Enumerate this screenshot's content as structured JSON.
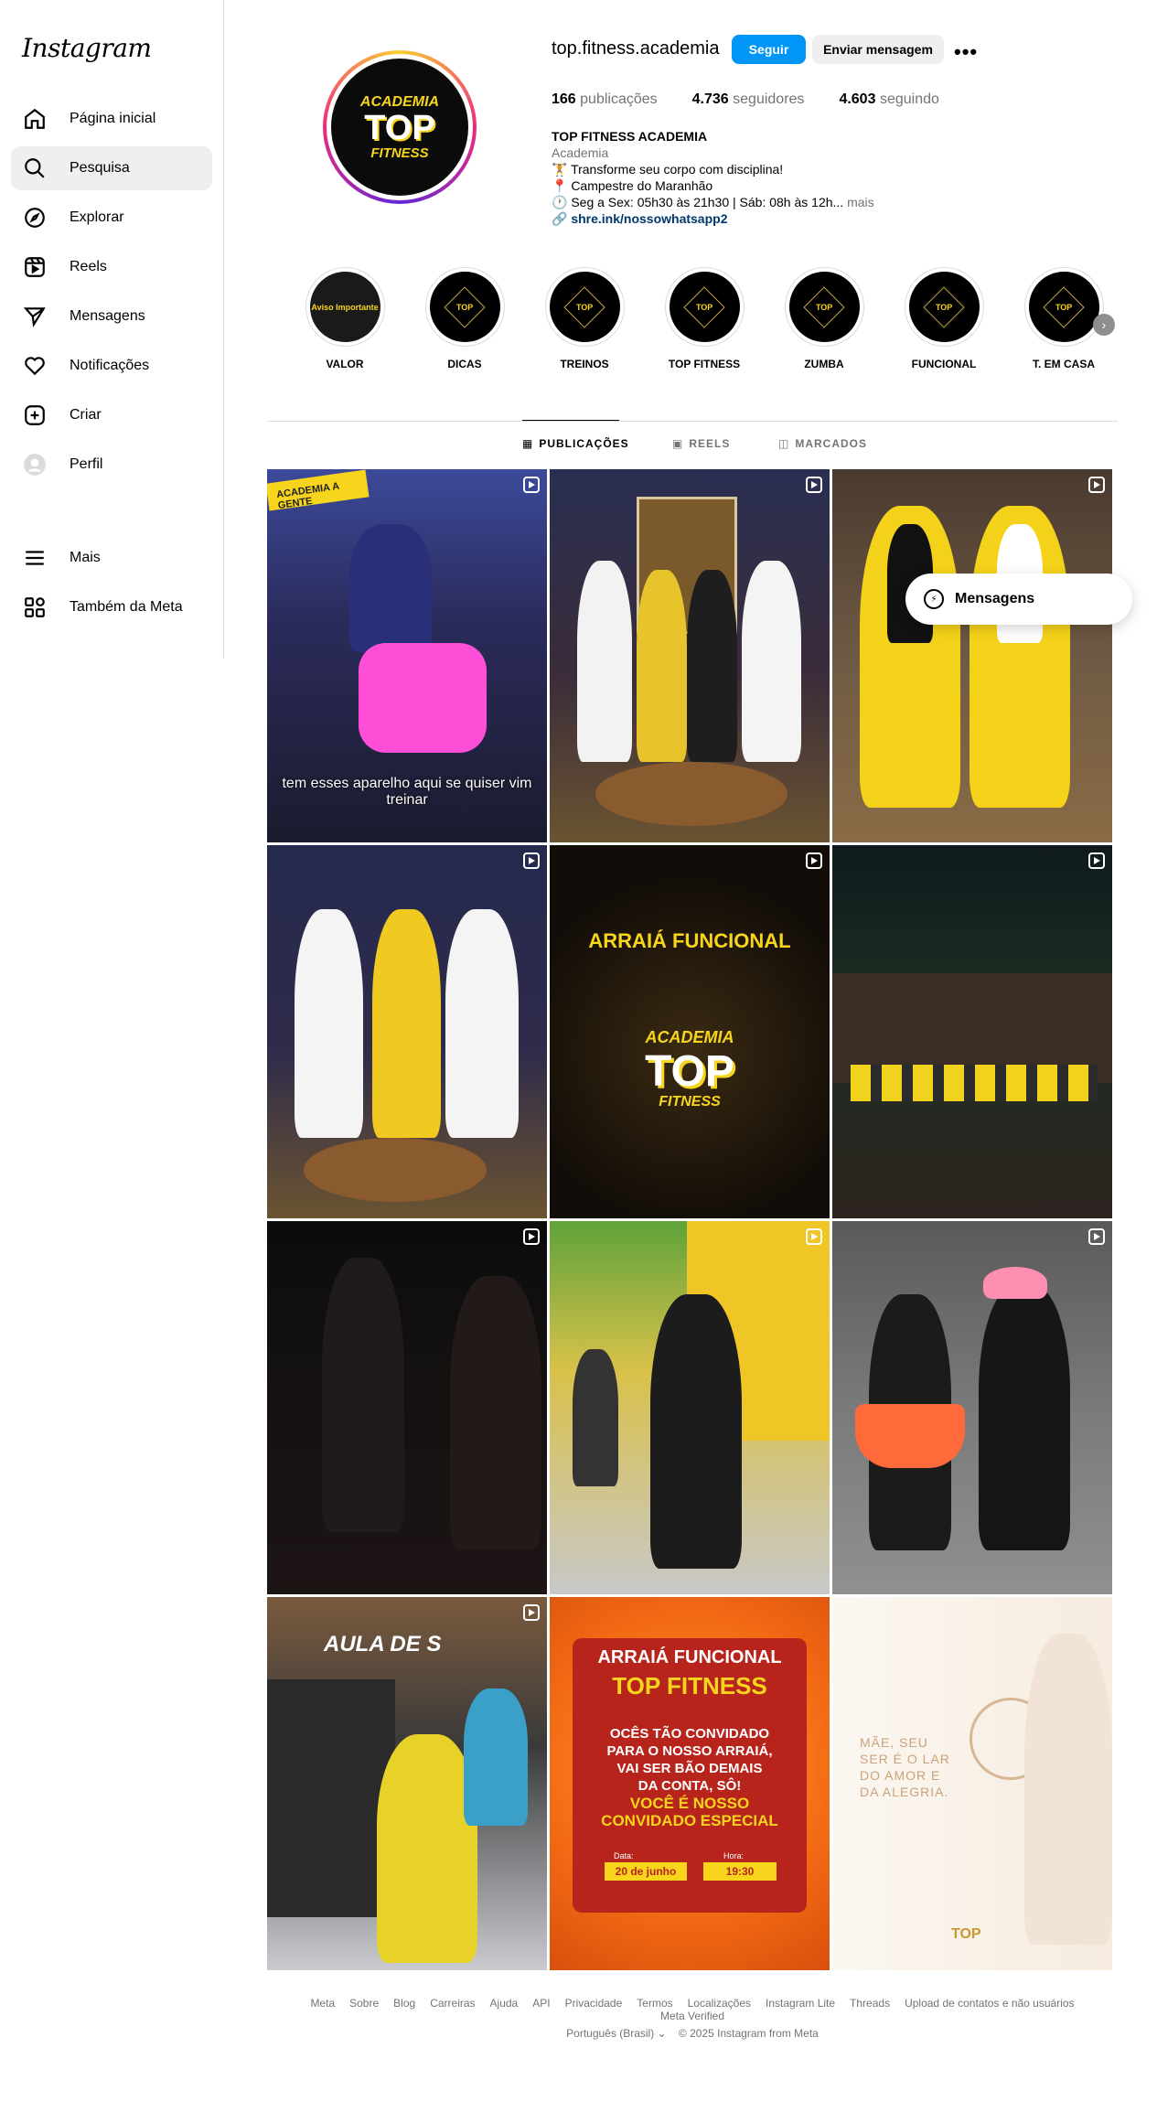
{
  "sidebar": {
    "logo": "Instagram",
    "items": [
      {
        "label": "Página inicial",
        "icon": "home-icon"
      },
      {
        "label": "Pesquisa",
        "icon": "search-icon"
      },
      {
        "label": "Explorar",
        "icon": "compass-icon"
      },
      {
        "label": "Reels",
        "icon": "reels-icon"
      },
      {
        "label": "Mensagens",
        "icon": "send-icon"
      },
      {
        "label": "Notificações",
        "icon": "heart-icon"
      },
      {
        "label": "Criar",
        "icon": "plus-square-icon"
      },
      {
        "label": "Perfil",
        "icon": "avatar-icon"
      }
    ],
    "more": "Mais",
    "meta": "Também da Meta",
    "active": "Pesquisa"
  },
  "profile": {
    "avatar": {
      "line1": "ACADEMIA",
      "line2": "TOP",
      "line3": "FITNESS"
    },
    "username": "top.fitness.academia",
    "follow_label": "Seguir",
    "message_label": "Enviar mensagem",
    "more_label": "•••",
    "stats": {
      "posts_count": "166",
      "posts_label": "publicações",
      "followers_count": "4.736",
      "followers_label": "seguidores",
      "following_count": "4.603",
      "following_label": "seguindo"
    },
    "bio": {
      "name": "TOP FITNESS ACADEMIA",
      "category": "Academia",
      "line1": "🏋️ Transforme seu corpo com disciplina!",
      "line2": "📍 Campestre do Maranhão",
      "line3": "🕐 Seg a Sex: 05h30 às 21h30 | Sáb: 08h às 12h...",
      "more": "mais",
      "link": "shre.ink/nossowhatsapp2"
    }
  },
  "highlights": [
    {
      "label": "VALOR",
      "inner": "Aviso Importante"
    },
    {
      "label": "DICAS",
      "inner": "TOP"
    },
    {
      "label": "TREINOS",
      "inner": "TOP"
    },
    {
      "label": "TOP FITNESS",
      "inner": "TOP"
    },
    {
      "label": "ZUMBA",
      "inner": "TOP"
    },
    {
      "label": "FUNCIONAL",
      "inner": "TOP"
    },
    {
      "label": "T. EM CASA",
      "inner": "TOP"
    }
  ],
  "tabs": {
    "posts": "PUBLICAÇÕES",
    "reels": "REELS",
    "tagged": "MARCADOS"
  },
  "posts": {
    "p1_caption": "tem esses aparelho aqui se quiser vim treinar",
    "p1_sign": "ACADEMIA A GENTE",
    "p5_title": "ARRAIÁ FUNCIONAL",
    "p5_l1": "ACADEMIA",
    "p5_l2": "TOP",
    "p5_l3": "FITNESS",
    "p10_title": "AULA DE S",
    "p11_title": "ARRAIÁ FUNCIONAL",
    "p11_sub": "TOP FITNESS",
    "p11_l1": "OCÊS TÃO CONVIDADO",
    "p11_l2": "PARA O NOSSO ARRAIÁ,",
    "p11_l3": "VAI SER BÃO DEMAIS",
    "p11_l4": "DA CONTA, SÔ!",
    "p11_l5": "VOCÊ É NOSSO",
    "p11_l6": "CONVIDADO ESPECIAL",
    "p11_date_label": "Data:",
    "p11_date": "20 de junho",
    "p11_time_label": "Hora:",
    "p11_time": "19:30",
    "p12_text": "MÃE, SEU SER É O LAR DO AMOR E DA ALEGRIA.",
    "p12_logo": "TOP"
  },
  "messages_bubble": "Mensagens",
  "footer": {
    "links": [
      "Meta",
      "Sobre",
      "Blog",
      "Carreiras",
      "Ajuda",
      "API",
      "Privacidade",
      "Termos",
      "Localizações",
      "Instagram Lite",
      "Threads",
      "Upload de contatos e não usuários",
      "Meta Verified"
    ],
    "language": "Português (Brasil) ⌄",
    "copyright": "© 2025 Instagram from Meta"
  },
  "colors": {
    "follow_blue": "#0095f6",
    "link_blue": "#00376b",
    "brand_yellow": "#f7d51d"
  }
}
